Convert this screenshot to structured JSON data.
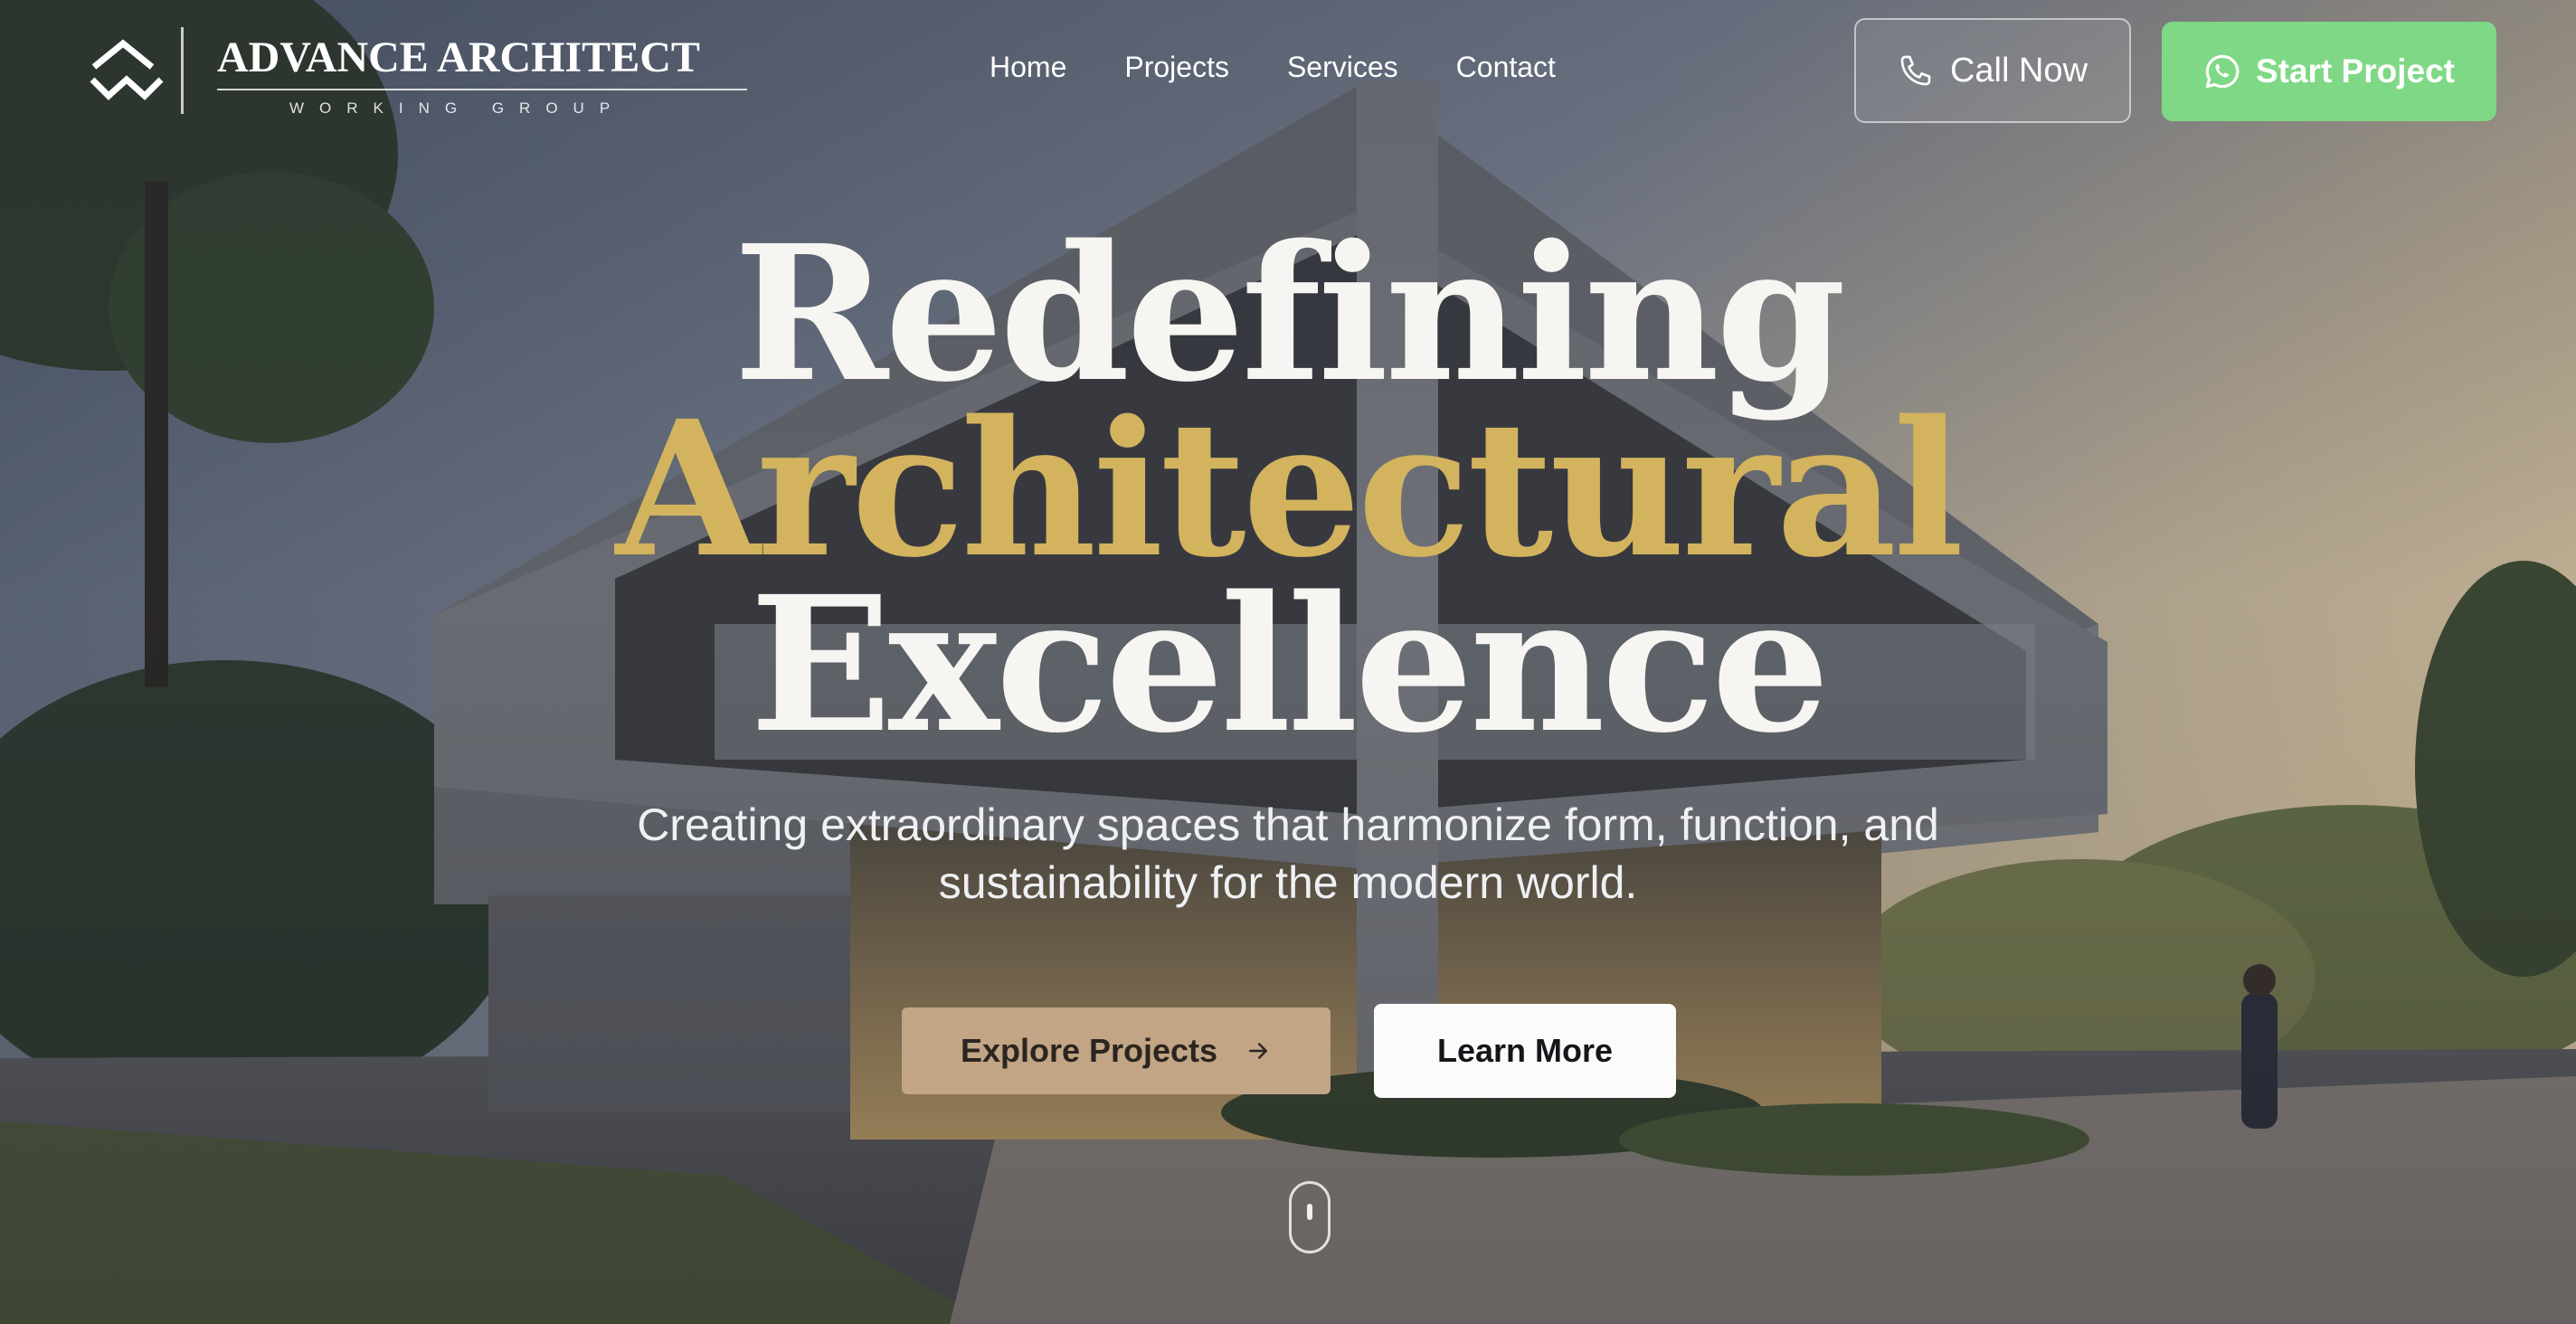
{
  "brand": {
    "name": "ADVANCE ARCHITECT",
    "tagline": "WORKING GROUP"
  },
  "nav": {
    "items": [
      "Home",
      "Projects",
      "Services",
      "Contact"
    ]
  },
  "header_actions": {
    "call_label": "Call Now",
    "call_icon": "phone-icon",
    "start_label": "Start Project",
    "start_icon": "whatsapp-icon",
    "start_color": "#7fd885"
  },
  "hero": {
    "line1": "Redefining",
    "line2": "Architectural",
    "line3": "Excellence",
    "accent_color": "#d3b35e",
    "subtitle_line1": "Creating extraordinary spaces that harmonize form, function, and",
    "subtitle_line2": "sustainability for the modern world."
  },
  "cta": {
    "explore_label": "Explore Projects",
    "explore_icon": "arrow-right-icon",
    "explore_color": "#c2a585",
    "learn_label": "Learn More"
  },
  "scroll_indicator": "mouse-scroll-icon"
}
